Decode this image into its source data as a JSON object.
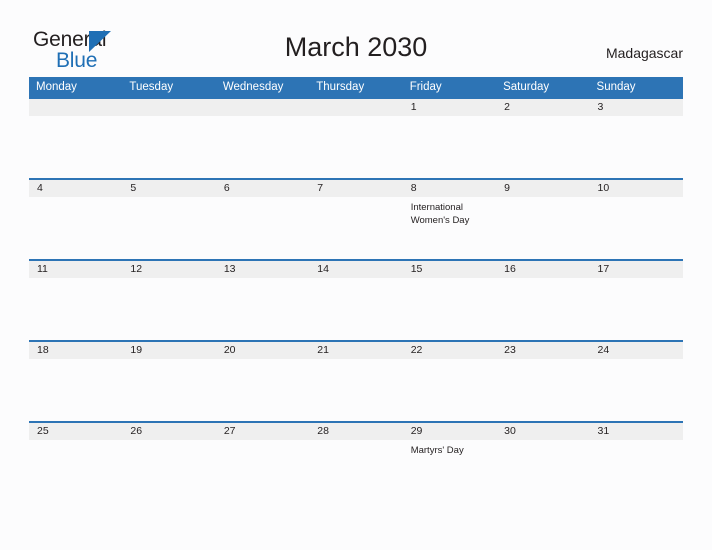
{
  "brand": {
    "name_part1": "General",
    "name_part2": "Blue",
    "triangle_icon": "blue-triangle-icon",
    "accent_color": "#1f6fb5"
  },
  "header": {
    "title": "March 2030",
    "country": "Madagascar"
  },
  "colors": {
    "header_blue": "#2d74b5",
    "band_gray": "#efefef",
    "page_background": "#fcfcfd",
    "text": "#231f20"
  },
  "calendar": {
    "month": "March",
    "year": "2030",
    "day_names": [
      "Monday",
      "Tuesday",
      "Wednesday",
      "Thursday",
      "Friday",
      "Saturday",
      "Sunday"
    ],
    "weeks": [
      {
        "days": [
          {
            "number": "",
            "event": ""
          },
          {
            "number": "",
            "event": ""
          },
          {
            "number": "",
            "event": ""
          },
          {
            "number": "",
            "event": ""
          },
          {
            "number": "1",
            "event": ""
          },
          {
            "number": "2",
            "event": ""
          },
          {
            "number": "3",
            "event": ""
          }
        ]
      },
      {
        "days": [
          {
            "number": "4",
            "event": ""
          },
          {
            "number": "5",
            "event": ""
          },
          {
            "number": "6",
            "event": ""
          },
          {
            "number": "7",
            "event": ""
          },
          {
            "number": "8",
            "event": "International Women's Day"
          },
          {
            "number": "9",
            "event": ""
          },
          {
            "number": "10",
            "event": ""
          }
        ]
      },
      {
        "days": [
          {
            "number": "11",
            "event": ""
          },
          {
            "number": "12",
            "event": ""
          },
          {
            "number": "13",
            "event": ""
          },
          {
            "number": "14",
            "event": ""
          },
          {
            "number": "15",
            "event": ""
          },
          {
            "number": "16",
            "event": ""
          },
          {
            "number": "17",
            "event": ""
          }
        ]
      },
      {
        "days": [
          {
            "number": "18",
            "event": ""
          },
          {
            "number": "19",
            "event": ""
          },
          {
            "number": "20",
            "event": ""
          },
          {
            "number": "21",
            "event": ""
          },
          {
            "number": "22",
            "event": ""
          },
          {
            "number": "23",
            "event": ""
          },
          {
            "number": "24",
            "event": ""
          }
        ]
      },
      {
        "days": [
          {
            "number": "25",
            "event": ""
          },
          {
            "number": "26",
            "event": ""
          },
          {
            "number": "27",
            "event": ""
          },
          {
            "number": "28",
            "event": ""
          },
          {
            "number": "29",
            "event": "Martyrs' Day"
          },
          {
            "number": "30",
            "event": ""
          },
          {
            "number": "31",
            "event": ""
          }
        ]
      }
    ]
  }
}
